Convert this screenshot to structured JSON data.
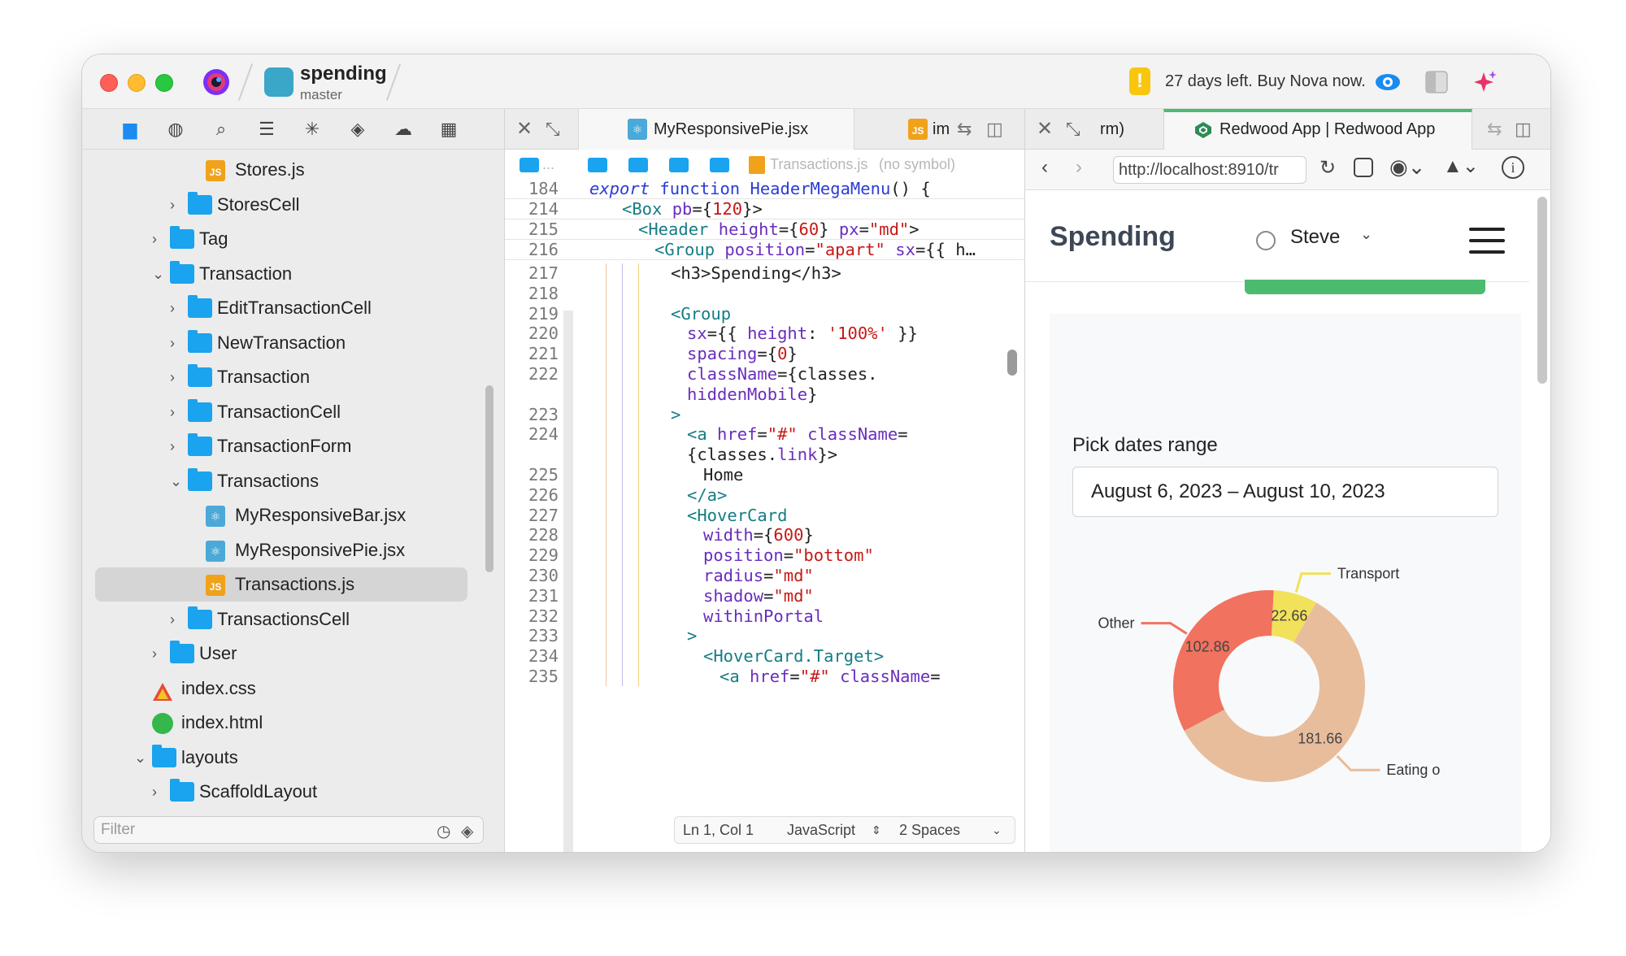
{
  "titlebar": {
    "project_name": "spending",
    "branch": "master",
    "trial_text": "27 days left. Buy Nova now."
  },
  "sidebar": {
    "toolbar_icons": [
      "folder-icon",
      "globe-icon",
      "search-icon",
      "list-icon",
      "asterisk-icon",
      "git-icon",
      "cloud-icon",
      "grid-icon"
    ],
    "tree": [
      {
        "label": "Stores.js",
        "type": "js",
        "indent": 3,
        "chevron": ""
      },
      {
        "label": "StoresCell",
        "type": "folder",
        "indent": 2,
        "chevron": "›"
      },
      {
        "label": "Tag",
        "type": "folder",
        "indent": 1,
        "chevron": "›"
      },
      {
        "label": "Transaction",
        "type": "folder",
        "indent": 1,
        "chevron": "⌄"
      },
      {
        "label": "EditTransactionCell",
        "type": "folder",
        "indent": 2,
        "chevron": "›"
      },
      {
        "label": "NewTransaction",
        "type": "folder",
        "indent": 2,
        "chevron": "›"
      },
      {
        "label": "Transaction",
        "type": "folder",
        "indent": 2,
        "chevron": "›"
      },
      {
        "label": "TransactionCell",
        "type": "folder",
        "indent": 2,
        "chevron": "›"
      },
      {
        "label": "TransactionForm",
        "type": "folder",
        "indent": 2,
        "chevron": "›"
      },
      {
        "label": "Transactions",
        "type": "folder",
        "indent": 2,
        "chevron": "⌄"
      },
      {
        "label": "MyResponsiveBar.jsx",
        "type": "jsx",
        "indent": 3,
        "chevron": ""
      },
      {
        "label": "MyResponsivePie.jsx",
        "type": "jsx",
        "indent": 3,
        "chevron": ""
      },
      {
        "label": "Transactions.js",
        "type": "js",
        "indent": 3,
        "chevron": "",
        "selected": true
      },
      {
        "label": "TransactionsCell",
        "type": "folder",
        "indent": 2,
        "chevron": "›"
      },
      {
        "label": "User",
        "type": "folder",
        "indent": 1,
        "chevron": "›"
      },
      {
        "label": "index.css",
        "type": "css",
        "indent": 0,
        "chevron": ""
      },
      {
        "label": "index.html",
        "type": "html",
        "indent": 0,
        "chevron": ""
      },
      {
        "label": "layouts",
        "type": "folder",
        "indent": 0,
        "chevron": "⌄"
      },
      {
        "label": "ScaffoldLayout",
        "type": "folder",
        "indent": 1,
        "chevron": "›"
      }
    ],
    "filter_placeholder": "Filter"
  },
  "editor": {
    "tab_active": "MyResponsivePie.jsx",
    "tab_other": "im",
    "breadcrumb_file": "Transactions.js",
    "breadcrumb_symbol": "(no symbol)",
    "breadcrumb_ellipsis": "...",
    "sticky_lines": [
      {
        "n": "184",
        "html": "<span class='k-it'>export</span> <span class='k-fn'>function</span> <span class='k-fn'>HeaderMegaMenu</span><span class='k-plain'>() {</span>",
        "indent": 0
      },
      {
        "n": "214",
        "html": "<span class='k-tag'>&lt;Box</span> <span class='k-attr'>pb</span><span class='k-plain'>={</span><span class='k-num'>120</span><span class='k-plain'>}&gt;</span>",
        "indent": 2
      },
      {
        "n": "215",
        "html": "<span class='k-tag'>&lt;Header</span> <span class='k-attr'>height</span><span class='k-plain'>={</span><span class='k-num'>60</span><span class='k-plain'>}</span> <span class='k-attr'>px</span><span class='k-plain'>=</span><span class='k-str'>\"md\"</span><span class='k-plain'>&gt;</span>",
        "indent": 3
      },
      {
        "n": "216",
        "html": "<span class='k-tag'>&lt;Group</span> <span class='k-attr'>position</span><span class='k-plain'>=</span><span class='k-str'>\"apart\"</span> <span class='k-attr'>sx</span><span class='k-plain'>={{ h…</span>",
        "indent": 4
      }
    ],
    "lines": [
      {
        "n": "217",
        "html": "<span class='k-plain'>&lt;h3&gt;Spending&lt;/h3&gt;</span>",
        "indent": 5
      },
      {
        "n": "218",
        "html": "",
        "indent": 0
      },
      {
        "n": "219",
        "html": "<span class='k-tag'>&lt;Group</span>",
        "indent": 5
      },
      {
        "n": "220",
        "html": "<span class='k-attr'>sx</span><span class='k-plain'>={{ </span><span class='k-attr'>height</span><span class='k-plain'>: </span><span class='k-str'>'100%'</span><span class='k-plain'> }}</span>",
        "indent": 6
      },
      {
        "n": "221",
        "html": "<span class='k-attr'>spacing</span><span class='k-plain'>={</span><span class='k-num'>0</span><span class='k-plain'>}</span>",
        "indent": 6
      },
      {
        "n": "222",
        "html": "<span class='k-attr'>className</span><span class='k-plain'>={classes.</span>",
        "indent": 6
      },
      {
        "n": "",
        "html": "<span class='k-attr'>hiddenMobile</span><span class='k-plain'>}</span>",
        "indent": 6
      },
      {
        "n": "223",
        "html": "<span class='k-tag'>&gt;</span>",
        "indent": 5
      },
      {
        "n": "224",
        "html": "<span class='k-tag'>&lt;a</span> <span class='k-attr'>href</span><span class='k-plain'>=</span><span class='k-str'>\"#\"</span> <span class='k-attr'>className</span><span class='k-plain'>=</span>",
        "indent": 6
      },
      {
        "n": "",
        "html": "<span class='k-plain'>{classes.</span><span class='k-attr'>link</span><span class='k-plain'>}&gt;</span>",
        "indent": 6
      },
      {
        "n": "225",
        "html": "<span class='k-plain'>Home</span>",
        "indent": 7
      },
      {
        "n": "226",
        "html": "<span class='k-tag'>&lt;/a&gt;</span>",
        "indent": 6
      },
      {
        "n": "227",
        "html": "<span class='k-tag'>&lt;HoverCard</span>",
        "indent": 6
      },
      {
        "n": "228",
        "html": "<span class='k-attr'>width</span><span class='k-plain'>={</span><span class='k-num'>600</span><span class='k-plain'>}</span>",
        "indent": 7
      },
      {
        "n": "229",
        "html": "<span class='k-attr'>position</span><span class='k-plain'>=</span><span class='k-str'>\"bottom\"</span>",
        "indent": 7
      },
      {
        "n": "230",
        "html": "<span class='k-attr'>radius</span><span class='k-plain'>=</span><span class='k-str'>\"md\"</span>",
        "indent": 7
      },
      {
        "n": "231",
        "html": "<span class='k-attr'>shadow</span><span class='k-plain'>=</span><span class='k-str'>\"md\"</span>",
        "indent": 7
      },
      {
        "n": "232",
        "html": "<span class='k-attr'>withinPortal</span>",
        "indent": 7
      },
      {
        "n": "233",
        "html": "<span class='k-tag'>&gt;</span>",
        "indent": 6
      },
      {
        "n": "234",
        "html": "<span class='k-tag'>&lt;HoverCard.Target&gt;</span>",
        "indent": 7
      },
      {
        "n": "235",
        "html": "<span class='k-tag'>&lt;a</span> <span class='k-attr'>href</span><span class='k-plain'>=</span><span class='k-str'>\"#\"</span> <span class='k-attr'>className</span><span class='k-plain'>=</span>",
        "indent": 8
      }
    ],
    "status": {
      "position": "Ln 1, Col 1",
      "language": "JavaScript",
      "indent": "2 Spaces"
    }
  },
  "browser": {
    "tab_partial": "rm)",
    "tab_active": "Redwood App | Redwood App",
    "url": "http://localhost:8910/tr",
    "app_title": "Spending",
    "user_name": "Steve",
    "dates_label": "Pick dates range",
    "dates_value": "August 6, 2023 – August 10, 2023"
  },
  "chart_data": {
    "type": "pie",
    "donut": true,
    "slices": [
      {
        "label": "Eating o",
        "value": 181.66,
        "color": "#e8bd9c"
      },
      {
        "label": "Other",
        "value": 102.86,
        "color": "#f1725e"
      },
      {
        "label": "Transport",
        "value": 22.66,
        "color": "#f1e15b"
      }
    ]
  },
  "colors": {
    "accent": "#1aa3ee",
    "selection": "#d5d5d5",
    "warning": "#f9c60e",
    "green_button": "#4cbb70"
  }
}
